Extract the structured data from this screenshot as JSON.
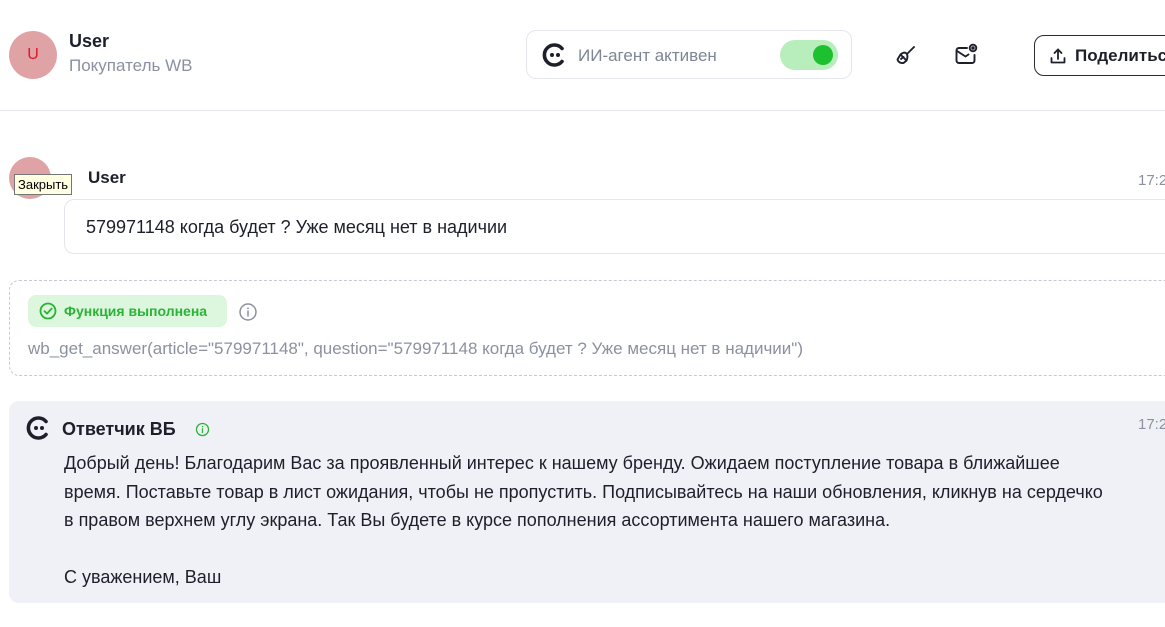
{
  "header": {
    "avatar_letter": "U",
    "user_name": "User",
    "user_role": "Покупатель WB",
    "agent_status": "ИИ-агент активен",
    "agent_enabled": true,
    "share_label": "Поделиться"
  },
  "tooltip": "Закрыть",
  "messages": {
    "user": {
      "name": "User",
      "time": "17:2",
      "text": "579971148 когда будет ? Уже месяц нет в надичии"
    },
    "function": {
      "badge": "Функция выполнена",
      "call": "wb_get_answer(article=\"579971148\", question=\"579971148 когда будет ? Уже месяц нет в надичии\")"
    },
    "answer": {
      "title": "Ответчик ВБ",
      "time": "17:2",
      "paragraph": "Добрый день! Благодарим Вас за проявленный интерес к нашему бренду. Ожидаем поступление товара в ближайшее время. Поставьте товар в лист ожидания, чтобы не пропустить. Подписывайтесь на наши обновления, кликнув на сердечко в правом верхнем углу экрана. Так Вы будете в курсе пополнения ассортимента нашего магазина.",
      "signature": "С уважением, Ваш"
    }
  },
  "colors": {
    "accent_green": "#1dc02f",
    "avatar_bg": "#dfa3a6",
    "avatar_letter": "#e0162b",
    "answer_bg": "#eff1f6"
  },
  "icons": [
    "agent-logo-icon",
    "broom-icon",
    "mail-settings-icon",
    "upload-icon",
    "check-circle-icon",
    "info-icon"
  ]
}
